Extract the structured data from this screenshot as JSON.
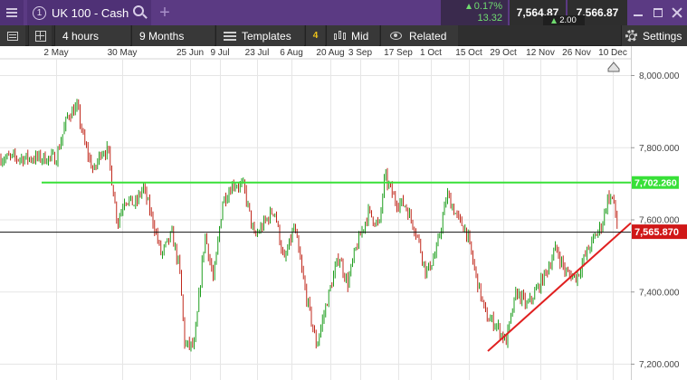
{
  "titlebar": {
    "instrument_number": "1",
    "instrument_name": "UK 100 - Cash",
    "change_percent": "0.17%",
    "change_points": "13.32",
    "sell_price": "7,564.87",
    "buy_price": "7,566.87",
    "spread": "2.00"
  },
  "toolbar": {
    "interval": "4 hours",
    "range": "9 Months",
    "templates_label": "Templates",
    "templates_count": "4",
    "price_type": "Mid",
    "related_label": "Related",
    "settings_label": "Settings"
  },
  "icons": {
    "menu": "hamburger-icon",
    "search": "search-icon",
    "add": "plus-icon",
    "panel": "panel-icon",
    "layout": "grid-icon",
    "templates": "sliders-icon",
    "candles": "candlestick-icon",
    "related": "eye-icon",
    "settings": "gear-icon",
    "window_minimize": "minimize-icon",
    "window_maximize": "maximize-icon",
    "window_close": "close-icon",
    "scroll_to_latest": "home-icon"
  },
  "colors": {
    "up_candle": "#1e9e1e",
    "down_candle": "#c0281c",
    "horizontal_line": "#38e038",
    "trend_line": "#e02020",
    "current_price_line": "#111111",
    "current_price_label": "#d01818",
    "horizontal_line_label": "#38e038",
    "brand_bar": "#5b3a83"
  },
  "chart_data": {
    "type": "candlestick",
    "x_tick_labels": [
      "2 May",
      "30 May",
      "25 Jun",
      "9 Jul",
      "23 Jul",
      "6 Aug",
      "20 Aug",
      "3 Sep",
      "17 Sep",
      "1 Oct",
      "15 Oct",
      "29 Oct",
      "12 Nov",
      "26 Nov",
      "10 Dec"
    ],
    "y_tick_labels": [
      "8,000.000",
      "7,800.000",
      "7,600.000",
      "7,400.000",
      "7,200.000"
    ],
    "y_ticks": [
      8000,
      7800,
      7600,
      7400,
      7200
    ],
    "ylim": [
      7180,
      8070
    ],
    "current_price": 7565.87,
    "current_price_label": "7,565.870",
    "horizontal_level": 7702.26,
    "horizontal_level_label": "7,702.260",
    "trend_line": {
      "from": [
        "29 Oct",
        7250
      ],
      "to": [
        "10 Dec",
        7570
      ]
    },
    "close_path": [
      [
        "2 May",
        7770
      ],
      [
        "7 May",
        7890
      ],
      [
        "11 May",
        7910
      ],
      [
        "14 May",
        7810
      ],
      [
        "18 May",
        7730
      ],
      [
        "21 May",
        7790
      ],
      [
        "24 May",
        7790
      ],
      [
        "28 May",
        7590
      ],
      [
        "31 May",
        7660
      ],
      [
        "4 Jun",
        7640
      ],
      [
        "7 Jun",
        7690
      ],
      [
        "11 Jun",
        7590
      ],
      [
        "14 Jun",
        7500
      ],
      [
        "18 Jun",
        7560
      ],
      [
        "21 Jun",
        7460
      ],
      [
        "23 Jun",
        7250
      ],
      [
        "27 Jun",
        7250
      ],
      [
        "2 Jul",
        7560
      ],
      [
        "6 Jul",
        7430
      ],
      [
        "10 Jul",
        7650
      ],
      [
        "14 Jul",
        7700
      ],
      [
        "18 Jul",
        7690
      ],
      [
        "22 Jul",
        7550
      ],
      [
        "26 Jul",
        7590
      ],
      [
        "30 Jul",
        7630
      ],
      [
        "3 Aug",
        7480
      ],
      [
        "7 Aug",
        7580
      ],
      [
        "11 Aug",
        7400
      ],
      [
        "15 Aug",
        7250
      ],
      [
        "19 Aug",
        7380
      ],
      [
        "24 Aug",
        7500
      ],
      [
        "28 Aug",
        7420
      ],
      [
        "1 Sep",
        7520
      ],
      [
        "6 Sep",
        7620
      ],
      [
        "10 Sep",
        7580
      ],
      [
        "12 Sep",
        7720
      ],
      [
        "16 Sep",
        7650
      ],
      [
        "20 Sep",
        7640
      ],
      [
        "25 Sep",
        7560
      ],
      [
        "29 Sep",
        7450
      ],
      [
        "3 Oct",
        7510
      ],
      [
        "7 Oct",
        7670
      ],
      [
        "11 Oct",
        7600
      ],
      [
        "14 Oct",
        7570
      ],
      [
        "18 Oct",
        7440
      ],
      [
        "22 Oct",
        7330
      ],
      [
        "26 Oct",
        7310
      ],
      [
        "30 Oct",
        7260
      ],
      [
        "3 Nov",
        7400
      ],
      [
        "7 Nov",
        7360
      ],
      [
        "11 Nov",
        7410
      ],
      [
        "14 Nov",
        7450
      ],
      [
        "18 Nov",
        7520
      ],
      [
        "22 Nov",
        7450
      ],
      [
        "26 Nov",
        7440
      ],
      [
        "30 Nov",
        7510
      ],
      [
        "3 Dec",
        7550
      ],
      [
        "6 Dec",
        7590
      ],
      [
        "8 Dec",
        7660
      ],
      [
        "10 Dec",
        7660
      ],
      [
        "12 Dec",
        7566
      ]
    ]
  }
}
